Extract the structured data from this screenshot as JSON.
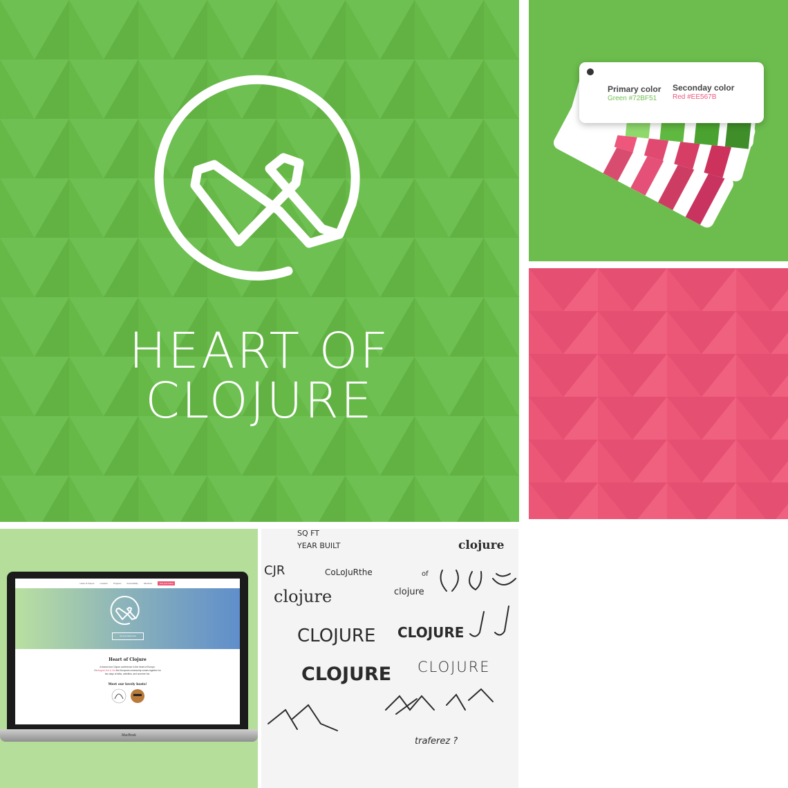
{
  "brand": {
    "line1": "HEART OF",
    "line2": "CLOJURE"
  },
  "palette": {
    "primary_title": "Primary color",
    "primary_value": "Green #72BF51",
    "primary_hex": "#72BF51",
    "secondary_title": "Seconday color",
    "secondary_value": "Red #EE567B",
    "secondary_hex": "#EE567B"
  },
  "laptop": {
    "nav": [
      "Heart of Clojure",
      "Location",
      "Program",
      "Accessibility",
      "Sketches"
    ],
    "nav_cta": "Get your ticket",
    "hero_button": "Get your tickets now!",
    "title": "Heart of Clojure",
    "text_line1": "A brand new Clojure conference in the heart of Europe.",
    "text_pre": "On",
    "text_dates": "August 2nd & 3rd",
    "text_post": "the European community comes together for",
    "text_line3": "two days of talks, activities, and summer fun.",
    "hosts_title": "Meet our lovely hosts!",
    "brand_label": "MacBook"
  },
  "sketches": {
    "s1": "SQ FT",
    "s2": "YEAR BUILT",
    "s3": "clojure",
    "s4": "CJR",
    "s5": "CoLoJuRthe",
    "s6": "of",
    "s7": "clojure",
    "s8": "clojure",
    "s9": "CLOJURE",
    "s10": "CLOJURE",
    "s11": "CLOJURE",
    "s12": "CLOJURE",
    "s13": "traferez ?"
  }
}
